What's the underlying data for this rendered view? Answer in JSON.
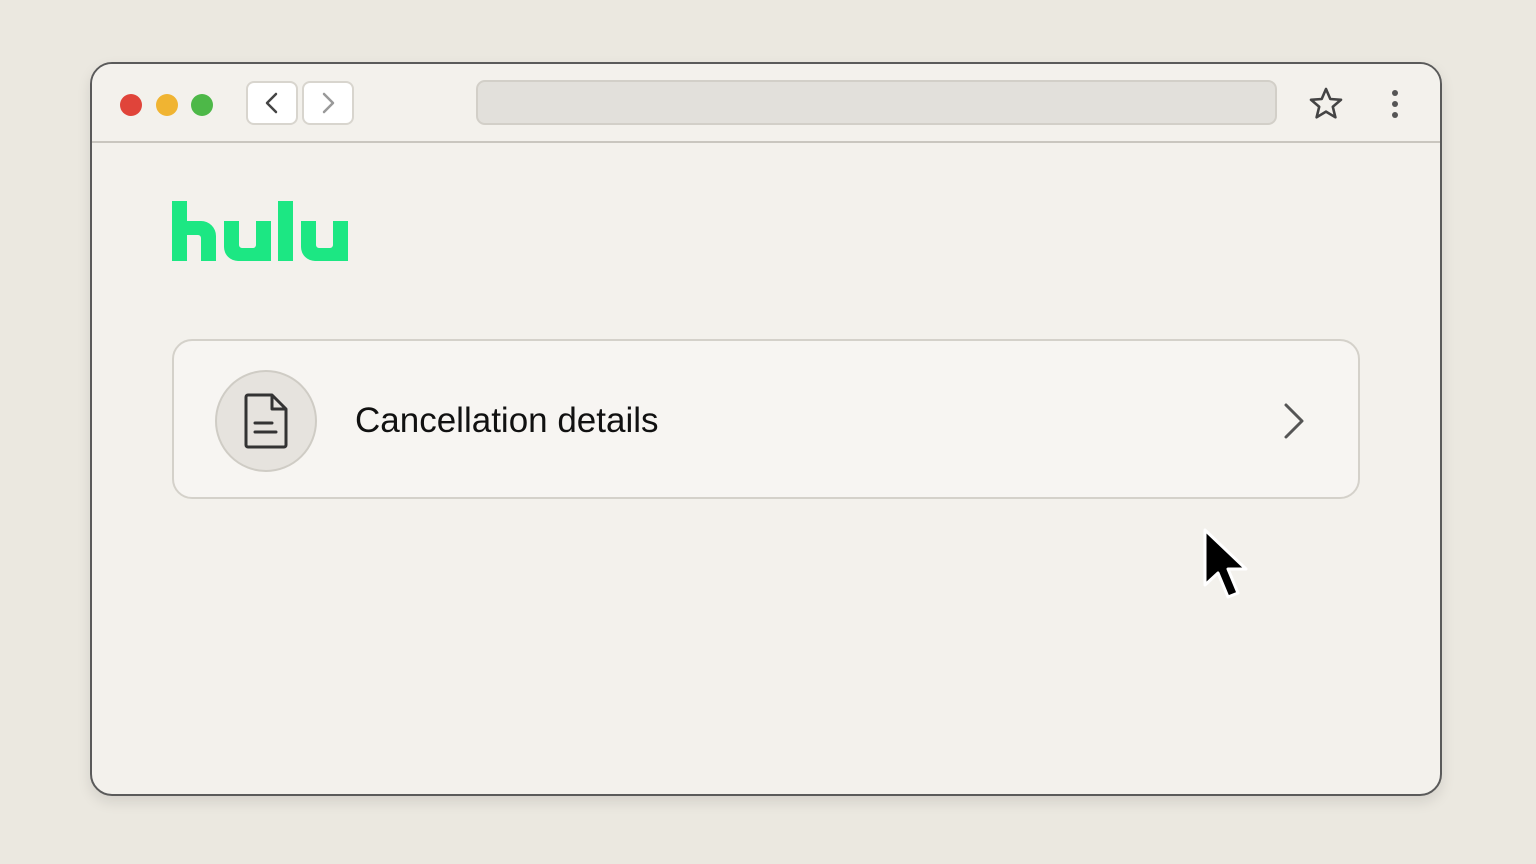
{
  "brand": {
    "name": "hulu",
    "color": "#1ce783"
  },
  "card": {
    "label": "Cancellation details",
    "icon": "document-icon",
    "chevron_icon": "chevron-right-icon"
  },
  "toolbar": {
    "back_icon": "chevron-left-icon",
    "forward_icon": "chevron-right-icon",
    "bookmark_icon": "star-icon",
    "menu_icon": "more-vertical-icon",
    "url": ""
  },
  "cursor_icon": "mouse-pointer-icon"
}
